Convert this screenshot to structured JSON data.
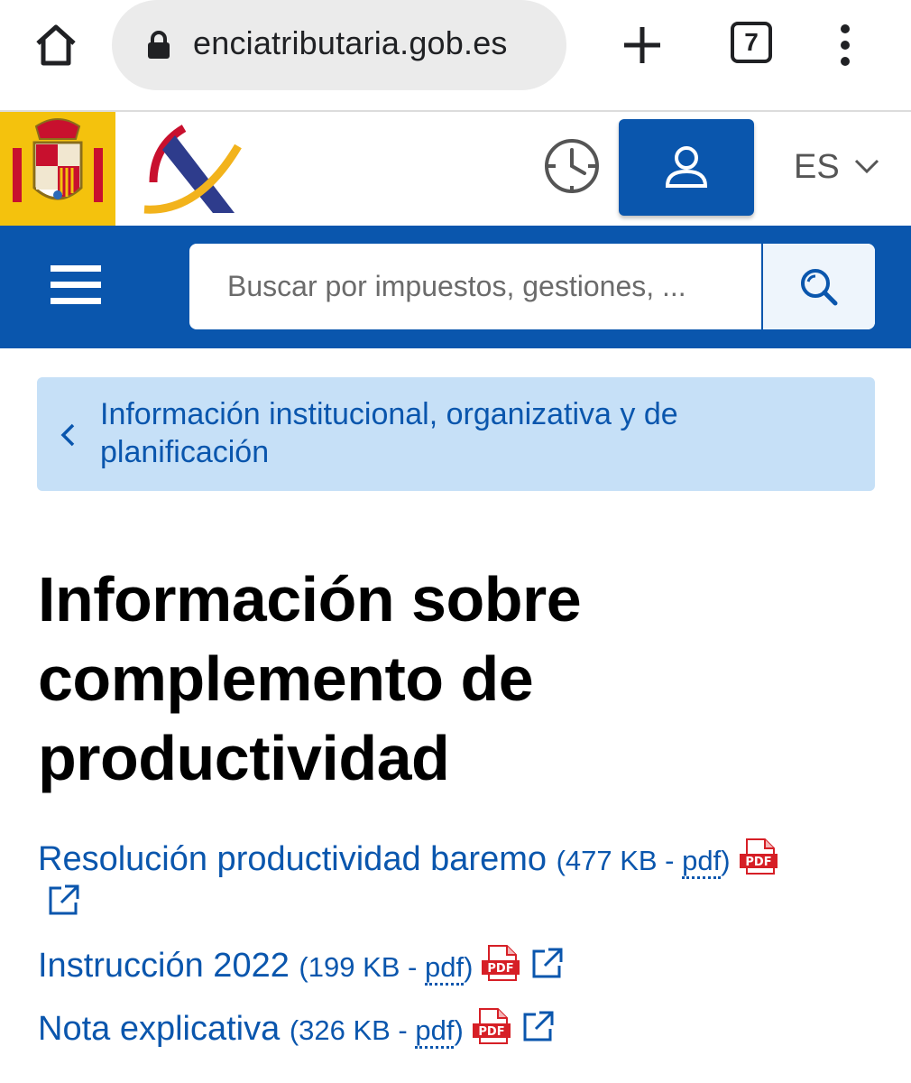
{
  "browser": {
    "url": "enciatributaria.gob.es",
    "tab_count": "7"
  },
  "header": {
    "language": "ES"
  },
  "search": {
    "placeholder": "Buscar por impuestos, gestiones, ..."
  },
  "breadcrumb": {
    "label": "Información institucional, organizativa y de planificación"
  },
  "page": {
    "title": "Información sobre complemento de productividad"
  },
  "documents": [
    {
      "title": "Resolución productividad baremo",
      "size": "(477 KB - ",
      "format": "pdf",
      "close": ")"
    },
    {
      "title": "Instrucción 2022",
      "size": "(199 KB - ",
      "format": "pdf",
      "close": ")"
    },
    {
      "title": "Nota explicativa",
      "size": "(326 KB - ",
      "format": "pdf",
      "close": ")"
    }
  ],
  "colors": {
    "primary_blue": "#0a56ad",
    "breadcrumb_bg": "#c6e0f7",
    "pdf_red": "#d61f26"
  }
}
